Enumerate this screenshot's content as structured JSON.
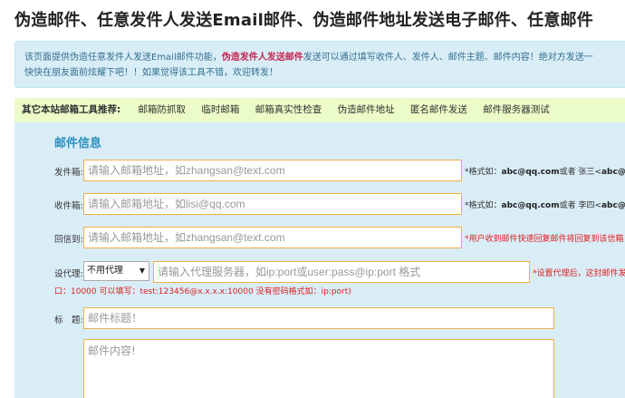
{
  "page_title": "伪造邮件、任意发件人发送Email邮件、伪造邮件地址发送电子邮件、任意邮件",
  "intro": {
    "line1_pre": "该页面提供伪造任意发件人发送Email邮件功能，",
    "line1_bold": "伪造发件人发送邮件",
    "line1_post": "发送可以通过填写收件人、发件人、邮件主题、邮件内容！绝对方发送一",
    "line2": "快快在朋友面前炫耀下吧！！如果觉得该工具不错，欢迎转发！"
  },
  "tools": {
    "title": "其它本站邮箱工具推荐:",
    "links": [
      "邮箱防抓取",
      "临时邮箱",
      "邮箱真实性检查",
      "伪造邮件地址",
      "匿名邮件发送",
      "邮件服务器测试"
    ]
  },
  "form": {
    "section_title": "邮件信息",
    "sender": {
      "label": "发件箱:",
      "placeholder": "请输入邮箱地址，如zhangsan@text.com",
      "hint_pre": "*格式如：",
      "hint_bold1": "abc@qq.com",
      "hint_mid": "或者 张三<",
      "hint_bold2": "abc@"
    },
    "recipient": {
      "label": "收件箱:",
      "placeholder": "请输入邮箱地址，如lisi@qq.com",
      "hint_pre": "*格式如：",
      "hint_bold1": "abc@qq.com",
      "hint_mid": "或者 李四<",
      "hint_bold2": "abc@"
    },
    "reply_to": {
      "label": "回信到:",
      "placeholder": "请输入邮箱地址，如zhangsan@text.com",
      "hint": "*用户收到邮件快速回复邮件将回复到该信箱"
    },
    "proxy": {
      "label": "设代理:",
      "select_value": "不用代理",
      "placeholder": "请输入代理服务器，如ip:port或user:pass@ip:port 格式",
      "hint": "*设置代理后，这封邮件发",
      "note": "口：10000 可以填写：test:123456@x.x.x.x:10000 没有密码格式如：ip:port)"
    },
    "subject": {
      "label": "标　题:",
      "placeholder": "邮件标题！"
    },
    "content": {
      "placeholder": "邮件内容!"
    }
  },
  "colors": {
    "intro_bg": "#d9edf7",
    "toolsbar_bg": "#ecfcc8",
    "input_border": "#f0ad4e",
    "accent": "#2a8fbd"
  }
}
